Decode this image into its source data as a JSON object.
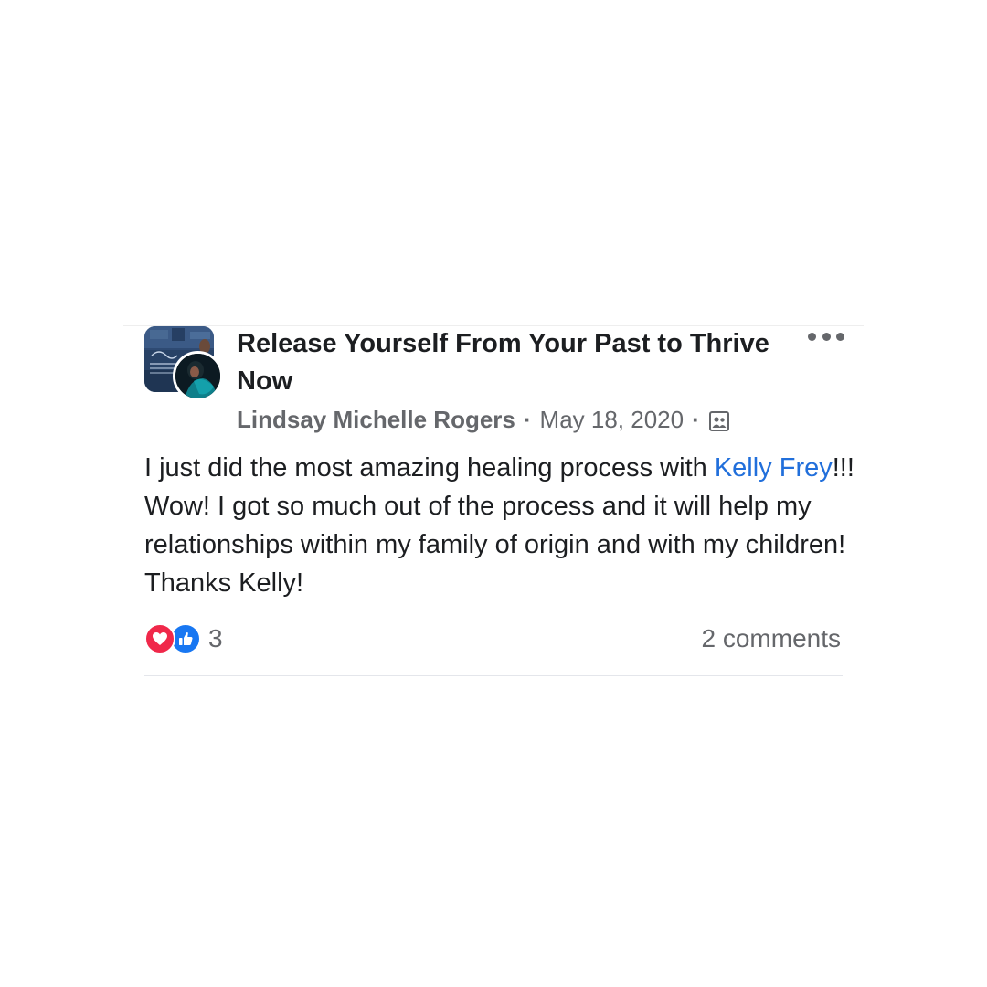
{
  "post": {
    "group_name": "Release Yourself From Your Past to Thrive Now",
    "author": "Lindsay Michelle Rogers",
    "separator": "·",
    "date": "May 18, 2020",
    "privacy_icon": "group-members-icon",
    "body": {
      "text_before_mention": "I just did the most amazing healing process with ",
      "mention": "Kelly Frey",
      "text_after_mention": "!!! Wow! I got so much out of the process and it will help my relationships within my family of origin and with my children! Thanks Kelly!"
    },
    "reactions": {
      "icons": [
        "love-icon",
        "like-icon"
      ],
      "count": "3"
    },
    "comments_label": "2 comments"
  },
  "colors": {
    "text_primary": "#1c1e21",
    "text_secondary": "#65676b",
    "mention": "#216fdb",
    "love": "#f0284a",
    "like": "#1877f2"
  }
}
